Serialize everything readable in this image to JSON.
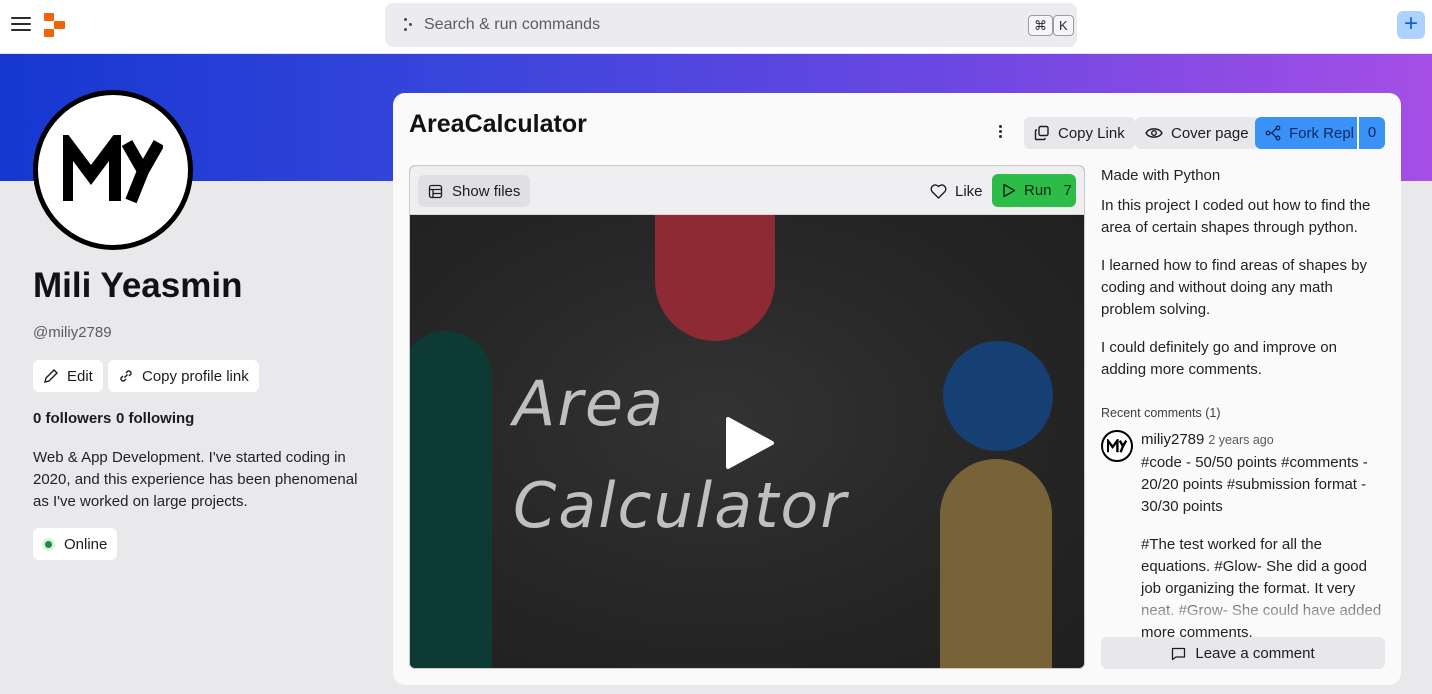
{
  "topbar": {
    "search_placeholder": "Search & run commands",
    "shortcut_cmd": "⌘",
    "shortcut_key": "K",
    "menu_icon": "hamburger-icon",
    "logo_icon": "replit-logo",
    "plus_icon": "plus-icon"
  },
  "profile": {
    "name": "Mili Yeasmin",
    "handle": "@miliy2789",
    "edit_label": "Edit",
    "copy_link_label": "Copy profile link",
    "followers": "0 followers",
    "following": "0 following",
    "bio": "Web & App Development. I've started coding in 2020, and this experience has been phenomenal as I've worked on large projects.",
    "status": "Online"
  },
  "repl": {
    "title": "AreaCalculator",
    "copy_link_label": "Copy Link",
    "cover_page_label": "Cover page",
    "fork_label": "Fork Repl",
    "fork_count": "0",
    "show_files_label": "Show files",
    "like_label": "Like",
    "run_label": "Run",
    "run_count": "7",
    "video_line1": "Area",
    "video_line2": "Calculator",
    "made_with": "Made with Python",
    "desc1": "In this project I coded out how to find the area of certain shapes through python.",
    "desc2": "I learned how to find areas of shapes by coding and without doing any math problem solving.",
    "desc3": "I could definitely go and improve on adding more comments."
  },
  "comments": {
    "header": "Recent comments (1)",
    "items": [
      {
        "user": "miliy2789",
        "time": "2 years ago",
        "para1": "#code - 50/50 points #comments - 20/20 points #submission format - 30/30 points",
        "para2": "#The test worked for all the equations. #Glow- She did a good job organizing the format. It very neat. #Grow- She could have added more comments."
      }
    ],
    "leave_label": "Leave a comment"
  },
  "colors": {
    "banner_start": "#1537d0",
    "banner_end": "#a54fe6",
    "run_green": "#2dbc48",
    "fork_blue": "#3b92f6",
    "online_green": "#1f8a3d"
  }
}
